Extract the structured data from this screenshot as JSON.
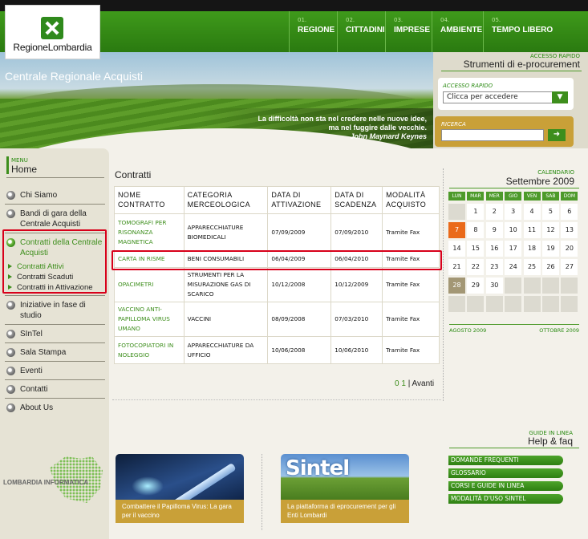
{
  "brand": {
    "name": "RegioneLombardia"
  },
  "topnav": [
    {
      "num": "01.",
      "label": "REGIONE"
    },
    {
      "num": "02.",
      "label": "CITTADINI"
    },
    {
      "num": "03.",
      "label": "IMPRESE"
    },
    {
      "num": "04.",
      "label": "AMBIENTE"
    },
    {
      "num": "05.",
      "label": "TEMPO LIBERO"
    }
  ],
  "banner": {
    "title": "Centrale Regionale Acquisti",
    "quote_line1": "La difficoltà non sta nel credere nelle nuove idee,",
    "quote_line2": "ma nel fuggire dalle vecchie.",
    "quote_author": "John Maynard Keynes"
  },
  "quick": {
    "caption": "ACCESSO RAPIDO",
    "heading": "Strumenti di e-procurement",
    "access_label": "ACCESSO RAPIDO",
    "access_value": "Clicca per accedere",
    "search_label": "RICERCA",
    "search_value": ""
  },
  "menu": {
    "caption": "MENU",
    "heading": "Home",
    "items": [
      {
        "label": "Chi Siamo"
      },
      {
        "label": "Bandi di gara della Centrale Acquisti"
      },
      {
        "label": "Contratti della Centrale Acquisti"
      },
      {
        "label": "Iniziative in fase di studio"
      },
      {
        "label": "SInTel"
      },
      {
        "label": "Sala Stampa"
      },
      {
        "label": "Eventi"
      },
      {
        "label": "Contatti"
      },
      {
        "label": "About Us"
      }
    ],
    "subitems": [
      {
        "label": "Contratti Attivi"
      },
      {
        "label": "Contratti Scaduti"
      },
      {
        "label": "Contratti in Attivazione"
      }
    ],
    "footer_logo": "LOMBARDIA INFORMATICA"
  },
  "contracts": {
    "title": "Contratti",
    "columns": [
      "NOME CONTRATTO",
      "CATEGORIA MERCEOLOGICA",
      "DATA DI ATTIVAZIONE",
      "DATA DI SCADENZA",
      "MODALITÀ ACQUISTO"
    ],
    "rows": [
      {
        "name": "TOMOGRAFI PER RISONANZA MAGNETICA",
        "category": "APPARECCHIATURE BIOMEDICALI",
        "start": "07/09/2009",
        "end": "07/09/2010",
        "mode": "Tramite Fax"
      },
      {
        "name": "CARTA IN RISME",
        "category": "BENI CONSUMABILI",
        "start": "06/04/2009",
        "end": "06/04/2010",
        "mode": "Tramite Fax"
      },
      {
        "name": "OPACIMETRI",
        "category": "STRUMENTI PER LA MISURAZIONE GAS DI SCARICO",
        "start": "10/12/2008",
        "end": "10/12/2009",
        "mode": "Tramite Fax"
      },
      {
        "name": "VACCINO ANTI-PAPILLOMA VIRUS UMANO",
        "category": "VACCINI",
        "start": "08/09/2008",
        "end": "07/03/2010",
        "mode": "Tramite Fax"
      },
      {
        "name": "FOTOCOPIATORI IN NOLEGGIO",
        "category": "APPARECCHIATURE DA UFFICIO",
        "start": "10/06/2008",
        "end": "10/06/2010",
        "mode": "Tramite Fax"
      }
    ],
    "pager": {
      "pages": "0 1",
      "sep": "|",
      "next": "Avanti"
    }
  },
  "calendar": {
    "caption": "CALENDARIO",
    "month": "Settembre 2009",
    "dows": [
      "LUN",
      "MAR",
      "MER",
      "GIO",
      "VEN",
      "SAB",
      "DOM"
    ],
    "days": [
      "",
      "1",
      "2",
      "3",
      "4",
      "5",
      "6",
      "7",
      "8",
      "9",
      "10",
      "11",
      "12",
      "13",
      "14",
      "15",
      "16",
      "17",
      "18",
      "19",
      "20",
      "21",
      "22",
      "23",
      "24",
      "25",
      "26",
      "27",
      "28",
      "29",
      "30",
      "",
      "",
      "",
      "",
      "",
      "",
      "",
      "",
      "",
      "",
      ""
    ],
    "today": "7",
    "prev": "AGOSTO 2009",
    "next": "OTTOBRE 2009"
  },
  "help": {
    "caption": "GUIDE IN LINEA",
    "heading": "Help & faq",
    "links": [
      "DOMANDE FREQUENTI",
      "GLOSSARIO",
      "CORSI E GUIDE IN LINEA",
      "MODALITÀ D'USO SINTEL"
    ]
  },
  "promos": [
    {
      "caption": "Combattere il Papilloma Virus: La gara per il vaccino"
    },
    {
      "title": "Sintel",
      "caption": "La piattaforma di eprocurement per gli Enti Lombardi"
    }
  ],
  "colors": {
    "brand_green": "#3d8e1c",
    "accent_gold": "#c9a038",
    "highlight_red": "#d8001a",
    "today_orange": "#ea6a1a"
  }
}
